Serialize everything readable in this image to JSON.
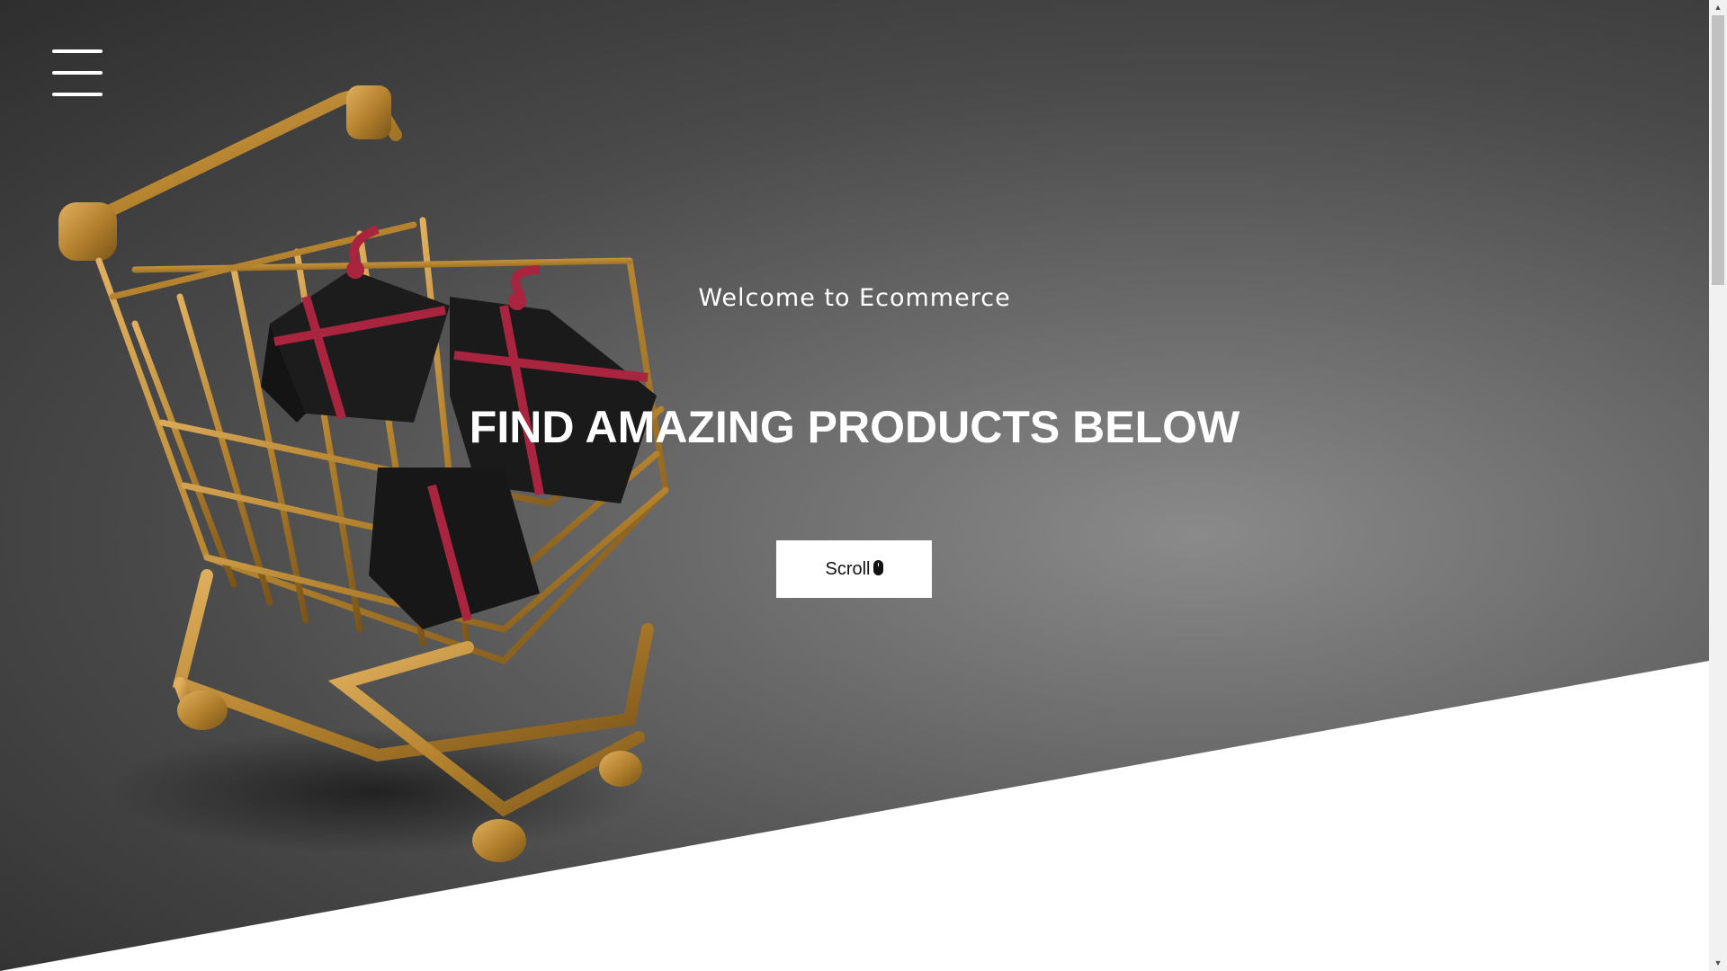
{
  "hero": {
    "welcome": "Welcome to Ecommerce",
    "headline": "FIND AMAZING PRODUCTS BELOW",
    "scroll_button_label": "Scroll",
    "scroll_button_icon": "mouse-icon",
    "menu_icon": "hamburger-menu-icon"
  },
  "scrollbar": {
    "up_arrow": "▲",
    "down_arrow": "▼"
  },
  "colors": {
    "hero_dark": "#2e2e2e",
    "hero_light": "#8a8a8a",
    "cart_gold": "#b5832e",
    "ribbon": "#a8243f",
    "gift_box": "#1c1c1c",
    "button_bg": "#ffffff"
  }
}
